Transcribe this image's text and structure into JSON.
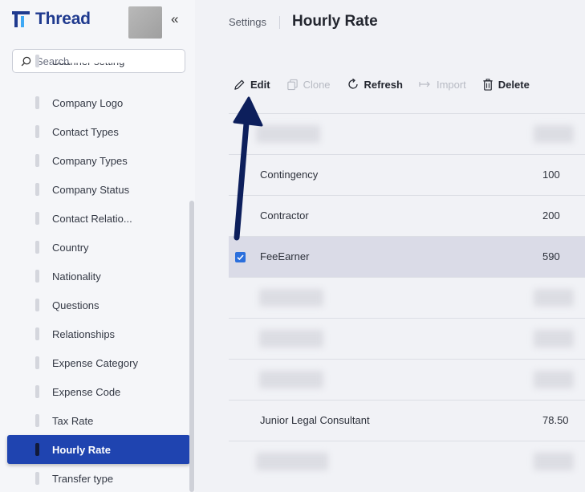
{
  "app": {
    "name": "Thread",
    "brand_color": "#1f3a8f",
    "accent_color": "#1f44b0"
  },
  "sidebar": {
    "search_placeholder": "Search",
    "items": [
      {
        "label": "Scanner setting",
        "active": false
      },
      {
        "label": "Company Logo",
        "active": false
      },
      {
        "label": "Contact Types",
        "active": false
      },
      {
        "label": "Company Types",
        "active": false
      },
      {
        "label": "Company Status",
        "active": false
      },
      {
        "label": "Contact Relatio...",
        "active": false
      },
      {
        "label": "Country",
        "active": false
      },
      {
        "label": "Nationality",
        "active": false
      },
      {
        "label": "Questions",
        "active": false
      },
      {
        "label": "Relationships",
        "active": false
      },
      {
        "label": "Expense Category",
        "active": false
      },
      {
        "label": "Expense Code",
        "active": false
      },
      {
        "label": "Tax Rate",
        "active": false
      },
      {
        "label": "Hourly Rate",
        "active": true
      },
      {
        "label": "Transfer type",
        "active": false
      }
    ]
  },
  "header": {
    "breadcrumb": "Settings",
    "title": "Hourly Rate"
  },
  "toolbar": {
    "edit": "Edit",
    "clone": "Clone",
    "refresh": "Refresh",
    "import": "Import",
    "delete": "Delete"
  },
  "grid": {
    "rows": [
      {
        "name": "",
        "rate": "",
        "blurred": true,
        "selected": false
      },
      {
        "name": "Contingency",
        "rate": "100",
        "blurred": false,
        "selected": false
      },
      {
        "name": "Contractor",
        "rate": "200",
        "blurred": false,
        "selected": false
      },
      {
        "name": "FeeEarner",
        "rate": "590",
        "blurred": false,
        "selected": true
      },
      {
        "name": "",
        "rate": "",
        "blurred": true,
        "selected": false
      },
      {
        "name": "",
        "rate": "",
        "blurred": true,
        "selected": false
      },
      {
        "name": "",
        "rate": "",
        "blurred": true,
        "selected": false
      },
      {
        "name": "Junior Legal Consultant",
        "rate": "78.50",
        "blurred": false,
        "selected": false
      },
      {
        "name": "",
        "rate": "",
        "blurred": true,
        "selected": false
      }
    ]
  },
  "annotation": {
    "type": "arrow",
    "color": "#0d1f5c",
    "points_to": "Edit"
  }
}
